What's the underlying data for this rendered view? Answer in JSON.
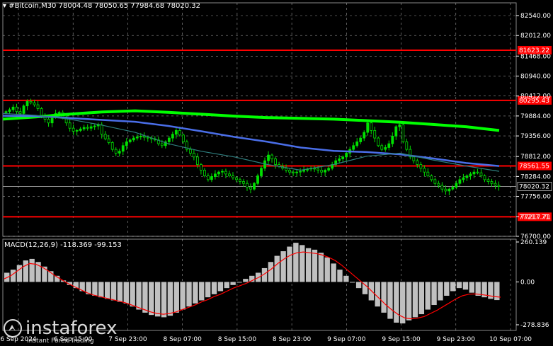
{
  "header": {
    "symbol": "#Bitcoin,M30",
    "ohlc": "78004.48 78050.65 77984.68 78020.32",
    "menu_icon": "triangle-down-icon"
  },
  "macd": {
    "label": "MACD(12,26,9) -118.369 -99.153"
  },
  "logo": {
    "name": "instaforex",
    "tagline": "Instant Forex Trading"
  },
  "colors": {
    "background": "#000000",
    "candles": "#00e000",
    "ma_slow": "#00ff00",
    "ma_mid": "#4a6ee8",
    "ma_fast": "#2f7f7f",
    "level_lines": "#ff0000",
    "macd_histogram": "#c0c0c0",
    "macd_signal": "#ff0000",
    "grid": "#ffffff"
  },
  "chart_data": [
    {
      "type": "candlestick",
      "symbol": "#Bitcoin",
      "timeframe": "M30",
      "y_axis_ticks": [
        82540.0,
        82012.0,
        81468.0,
        80940.0,
        80412.0,
        79884.0,
        79356.0,
        78812.0,
        78284.0,
        77756.0,
        77217.71,
        76700.0
      ],
      "ylim": [
        76700,
        82540
      ],
      "x_axis_ticks": [
        "6 Sep 2024",
        "6 Sep 15:00",
        "7 Sep 23:00",
        "8 Sep 07:00",
        "8 Sep 15:00",
        "8 Sep 23:00",
        "9 Sep 07:00",
        "9 Sep 15:00",
        "9 Sep 23:00",
        "10 Sep 07:00"
      ],
      "horizontal_levels": [
        {
          "value": 81623.22,
          "label": "81623.22",
          "color": "#ff0000"
        },
        {
          "value": 80295.43,
          "label": "80295.43",
          "color": "#ff0000"
        },
        {
          "value": 78561.55,
          "label": "78561.55",
          "color": "#ff0000"
        },
        {
          "value": 77217.71,
          "label": "77217.71",
          "color": "#ff0000"
        }
      ],
      "current_price": {
        "value": 78020.32,
        "label": "78020.32"
      },
      "closes": [
        80000,
        80050,
        80120,
        80000,
        79950,
        80150,
        80270,
        80230,
        80180,
        80080,
        79900,
        79800,
        79700,
        79850,
        79950,
        79980,
        79860,
        79700,
        79560,
        79480,
        79500,
        79540,
        79580,
        79560,
        79600,
        79620,
        79650,
        79400,
        79280,
        79180,
        79000,
        78900,
        78950,
        79100,
        79200,
        79250,
        79300,
        79330,
        79350,
        79320,
        79300,
        79280,
        79250,
        79150,
        79100,
        79200,
        79300,
        79400,
        79500,
        79380,
        79200,
        79000,
        78900,
        78800,
        78600,
        78450,
        78300,
        78200,
        78280,
        78350,
        78400,
        78420,
        78350,
        78300,
        78250,
        78200,
        78150,
        78100,
        78000,
        77950,
        78100,
        78300,
        78500,
        78700,
        78850,
        78750,
        78600,
        78550,
        78500,
        78450,
        78400,
        78380,
        78400,
        78420,
        78450,
        78480,
        78500,
        78480,
        78450,
        78400,
        78450,
        78500,
        78600,
        78700,
        78750,
        78800,
        78900,
        79000,
        79100,
        79200,
        79300,
        79450,
        79700,
        79500,
        79300,
        79100,
        79000,
        79050,
        79150,
        79350,
        79600,
        79650,
        79200,
        79000,
        78800,
        78700,
        78600,
        78500,
        78400,
        78300,
        78200,
        78100,
        78050,
        77950,
        77900,
        77950,
        78000,
        78100,
        78200,
        78250,
        78300,
        78350,
        78400,
        78380,
        78300,
        78200,
        78150,
        78100,
        78050,
        78020
      ],
      "moving_averages": [
        {
          "color": "#00ff00",
          "values": [
            79800,
            79860,
            79930,
            79990,
            80020,
            79980,
            79930,
            79880,
            79840,
            79820,
            79800,
            79760,
            79720,
            79660,
            79600,
            79500
          ]
        },
        {
          "color": "#4a6ee8",
          "values": [
            79890,
            79880,
            79830,
            79780,
            79730,
            79620,
            79480,
            79330,
            79200,
            79050,
            78960,
            78930,
            78870,
            78760,
            78640,
            78560
          ]
        },
        {
          "color": "#2f7f7f",
          "values": [
            79950,
            79900,
            79800,
            79640,
            79450,
            79150,
            78950,
            78800,
            78600,
            78450,
            78600,
            78820,
            78900,
            78720,
            78560,
            78420
          ]
        }
      ]
    },
    {
      "type": "macd",
      "label": "MACD(12,26,9)",
      "main_value": -118.369,
      "signal_value": -99.153,
      "y_axis_ticks": [
        260.139,
        0.0,
        -278.836
      ],
      "ylim": [
        -278.836,
        260.139
      ],
      "histogram": [
        60,
        80,
        110,
        140,
        150,
        130,
        100,
        70,
        40,
        10,
        -20,
        -40,
        -60,
        -80,
        -90,
        -100,
        -110,
        -120,
        -130,
        -140,
        -160,
        -180,
        -200,
        -215,
        -225,
        -230,
        -220,
        -200,
        -180,
        -160,
        -140,
        -120,
        -100,
        -80,
        -60,
        -40,
        -20,
        0,
        20,
        40,
        60,
        90,
        130,
        170,
        200,
        230,
        255,
        240,
        220,
        210,
        190,
        160,
        120,
        80,
        40,
        0,
        -40,
        -80,
        -120,
        -160,
        -200,
        -240,
        -265,
        -270,
        -250,
        -230,
        -210,
        -180,
        -150,
        -120,
        -90,
        -60,
        -40,
        -50,
        -70,
        -90,
        -100,
        -110,
        -118
      ],
      "signal": [
        20,
        40,
        70,
        100,
        120,
        115,
        95,
        70,
        40,
        15,
        -10,
        -30,
        -50,
        -70,
        -85,
        -95,
        -105,
        -115,
        -125,
        -135,
        -150,
        -165,
        -180,
        -195,
        -205,
        -210,
        -205,
        -195,
        -180,
        -165,
        -150,
        -130,
        -115,
        -95,
        -80,
        -60,
        -40,
        -25,
        -10,
        10,
        30,
        55,
        85,
        120,
        150,
        175,
        190,
        195,
        190,
        185,
        175,
        160,
        140,
        110,
        75,
        40,
        5,
        -30,
        -70,
        -110,
        -150,
        -185,
        -215,
        -235,
        -240,
        -235,
        -225,
        -205,
        -185,
        -160,
        -135,
        -110,
        -90,
        -80,
        -78,
        -82,
        -88,
        -95,
        -99
      ]
    }
  ]
}
